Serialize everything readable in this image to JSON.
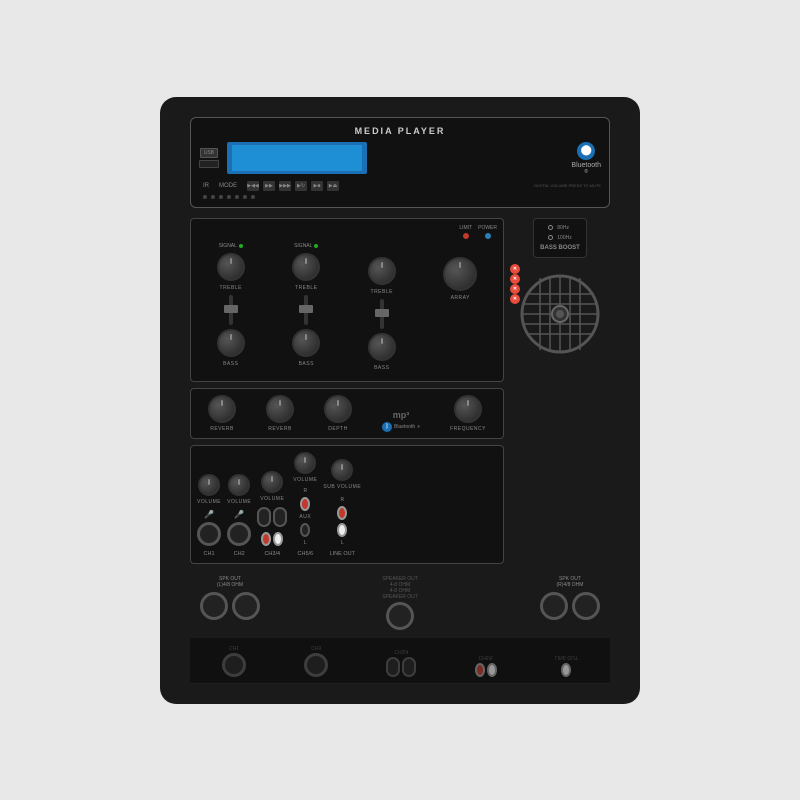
{
  "panel": {
    "title": "MEDIA PLAYER",
    "bluetooth": {
      "text": "Bluetooth",
      "symbol": "ᛒ"
    },
    "usb_label": "USB",
    "ir_label": "IR",
    "mode_label": "MODE",
    "digital_label": "DIGITAL VOLUME PRESS TO MUTE",
    "indicators": {
      "limit": "LIMIT",
      "power": "POWER",
      "array": "ARRAY"
    },
    "bass_boost": {
      "options": [
        "80Hz",
        "100Hz"
      ],
      "label": "BASS BOOST"
    },
    "mp3_logo": "mp³",
    "frequency_label": "FREQUENCY",
    "sub_volume_label": "SUB VOLUME",
    "channels": {
      "ch1": "CH1",
      "ch2": "CH2",
      "ch3_4": "CH3/4",
      "ch5_6": "CH5/6",
      "line_out": "LINE OUT"
    },
    "eq_labels": {
      "signal": "SIGNAL",
      "treble": "TREBLE",
      "bass": "BASS",
      "reverb": "REVERB",
      "depth": "DEPTH",
      "volume": "VOLUME"
    },
    "spk_out": {
      "left": "SPK OUT\n(L)4/8 OHM",
      "right": "SPK OUT\n(R)4/8 OHM",
      "speaker_out": "SPEAKER OUT\n4-8 OHM\n4-8 OHM\nSPEAKER OUT"
    },
    "aux_label": "AUX"
  }
}
